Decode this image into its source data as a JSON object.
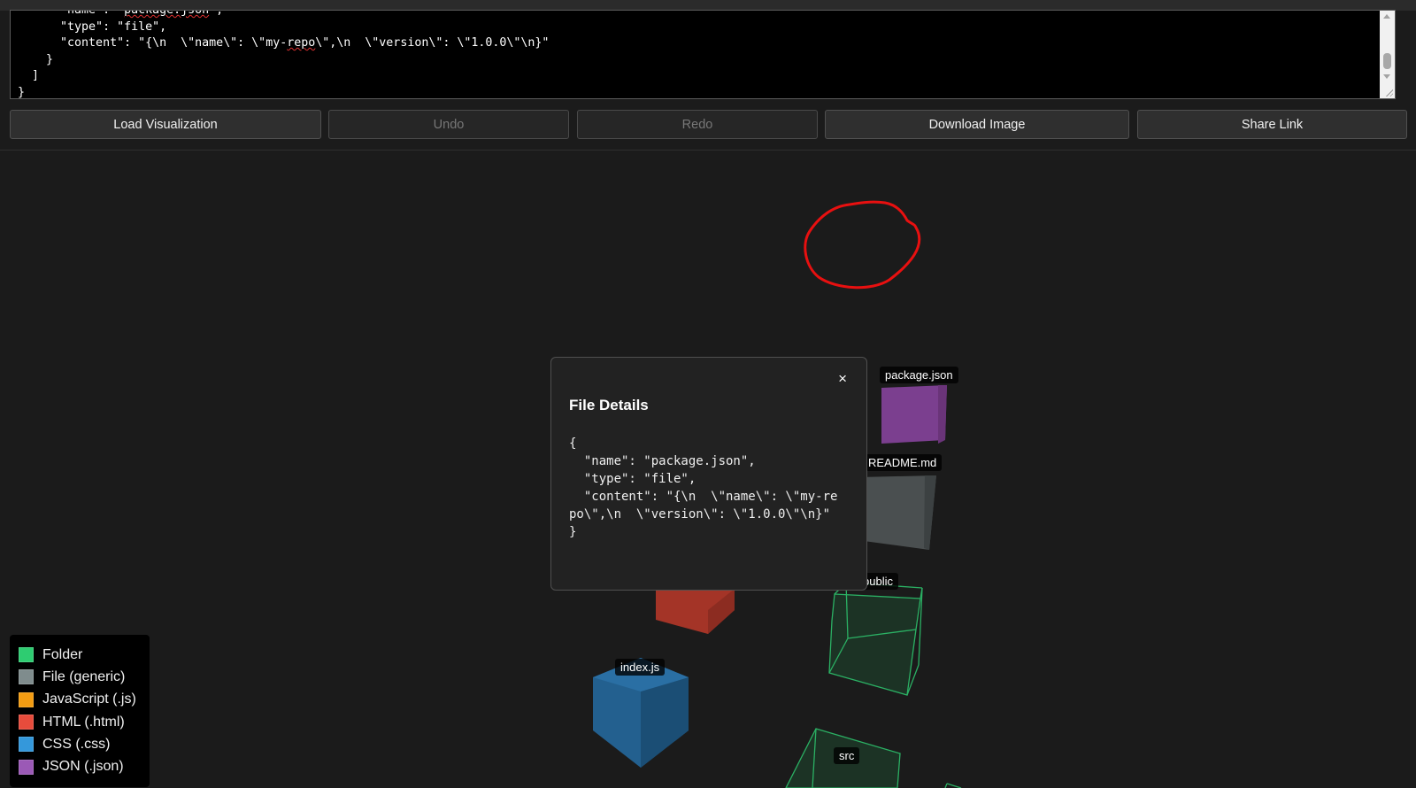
{
  "editor": {
    "lines": [
      "      \"name\": \"package.json\",",
      "      \"type\": \"file\",",
      "      \"content\": \"{\\n  \\\"name\\\": \\\"my-repo\\\",\\n  \\\"version\\\": \\\"1.0.0\\\"\\n}\"",
      "    }",
      "  ]",
      "}"
    ]
  },
  "toolbar": {
    "load": "Load Visualization",
    "undo": "Undo",
    "redo": "Redo",
    "download": "Download Image",
    "share": "Share Link"
  },
  "scene": {
    "labels": {
      "package_json": "package.json",
      "readme": "README.md",
      "public": "public",
      "index_js": "index.js",
      "src": "src"
    }
  },
  "modal": {
    "close": "×",
    "title": "File Details",
    "content": "{\n  \"name\": \"package.json\",\n  \"type\": \"file\",\n  \"content\": \"{\\n  \\\"name\\\": \\\"my-repo\\\",\\n  \\\"version\\\": \\\"1.0.0\\\"\\n}\"\n}"
  },
  "legend": {
    "items": [
      {
        "label": "Folder",
        "color": "#2ecc71"
      },
      {
        "label": "File (generic)",
        "color": "#7f8c8d"
      },
      {
        "label": "JavaScript (.js)",
        "color": "#f39c12"
      },
      {
        "label": "HTML (.html)",
        "color": "#e74c3c"
      },
      {
        "label": "CSS (.css)",
        "color": "#3498db"
      },
      {
        "label": "JSON (.json)",
        "color": "#9b59b6"
      }
    ]
  },
  "colors": {
    "folder_wire": "#2ecc71",
    "json_box": "#7b3f8f",
    "generic_box": "#4a4f50",
    "html_box": "#a43427",
    "css_box": "#23608f",
    "annotation": "#e81010"
  }
}
